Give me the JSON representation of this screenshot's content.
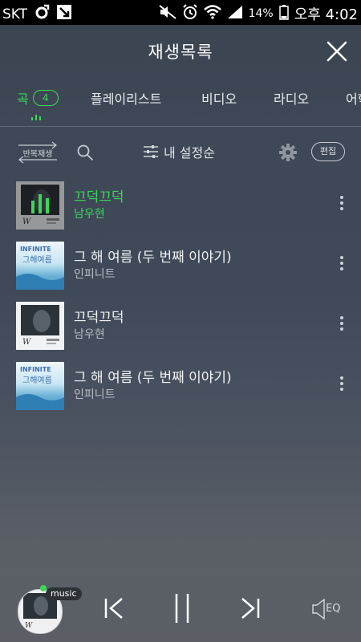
{
  "status_bar": {
    "carrier": "SKT",
    "battery": "14%",
    "time": "오후 4:02"
  },
  "header": {
    "title": "재생목록"
  },
  "tabs": [
    {
      "label": "곡",
      "count": "4",
      "active": true
    },
    {
      "label": "플레이리스트"
    },
    {
      "label": "비디오"
    },
    {
      "label": "라디오"
    },
    {
      "label": "어학"
    }
  ],
  "toolbar": {
    "repeat_label": "반복재생",
    "sort_label": "내 설정순",
    "edit_label": "편집"
  },
  "songs": [
    {
      "title": "끄덕끄덕",
      "artist": "남우현",
      "playing": true
    },
    {
      "title": "그 해 여름 (두 번째 이야기)",
      "artist": "인피니트"
    },
    {
      "title": "끄덕끄덕",
      "artist": "남우현"
    },
    {
      "title": "그 해 여름 (두 번째 이야기)",
      "artist": "인피니트"
    }
  ],
  "player": {
    "badge": "music",
    "eq_label": "EQ"
  },
  "colors": {
    "accent": "#3dd65a",
    "background": "#3f4958"
  }
}
